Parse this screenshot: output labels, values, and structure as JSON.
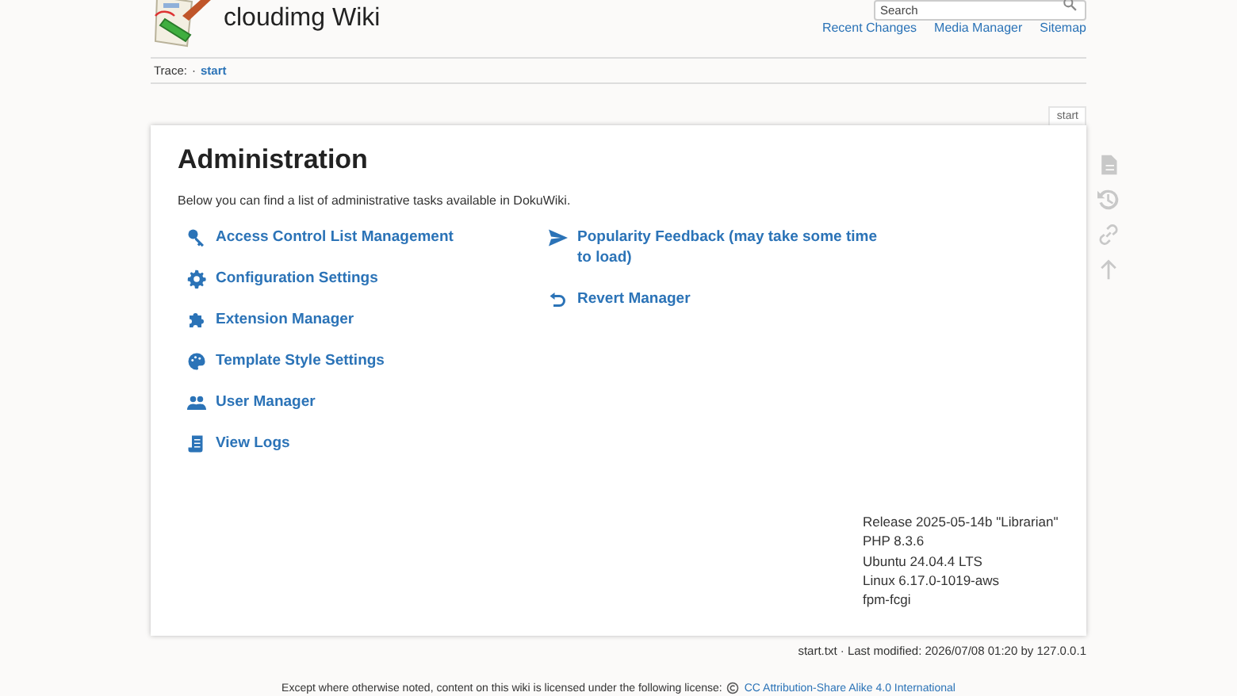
{
  "site": {
    "title": "cloudimg Wiki",
    "search": {
      "placeholder": "Search"
    },
    "links": [
      "Recent Changes",
      "Media Manager",
      "Sitemap"
    ]
  },
  "trace": {
    "label": "Trace:",
    "separator": "·",
    "crumb": "start"
  },
  "page_tab": "start",
  "heading": "Administration",
  "intro": "Below you can find a list of administrative tasks available in DokuWiki.",
  "tasks_left": [
    {
      "kind": "key",
      "label": "Access Control List Management"
    },
    {
      "kind": "gear",
      "label": "Configuration Settings"
    },
    {
      "kind": "puzzle",
      "label": "Extension Manager"
    },
    {
      "kind": "palette",
      "label": "Template Style Settings"
    },
    {
      "kind": "users",
      "label": "User Manager"
    },
    {
      "kind": "log",
      "label": "View Logs"
    }
  ],
  "tasks_right": [
    {
      "kind": "send",
      "label": "Popularity Feedback (may take some time to load)"
    },
    {
      "kind": "revert",
      "label": "Revert Manager"
    }
  ],
  "version_info": [
    "Release 2025-05-14b \"Librarian\"",
    "PHP 8.3.6",
    "Ubuntu 24.04.4 LTS",
    "Linux 6.17.0-1019-aws",
    "fpm-fcgi"
  ],
  "page_tools": [
    {
      "kind": "document"
    },
    {
      "kind": "history"
    },
    {
      "kind": "link"
    },
    {
      "kind": "top"
    }
  ],
  "doc_info": "start.txt · Last modified: 2026/07/08 01:20 by 127.0.0.1",
  "license": {
    "text": "Except where otherwise noted, content on this wiki is licensed under the following license:",
    "link": "CC Attribution-Share Alike 4.0 International"
  }
}
